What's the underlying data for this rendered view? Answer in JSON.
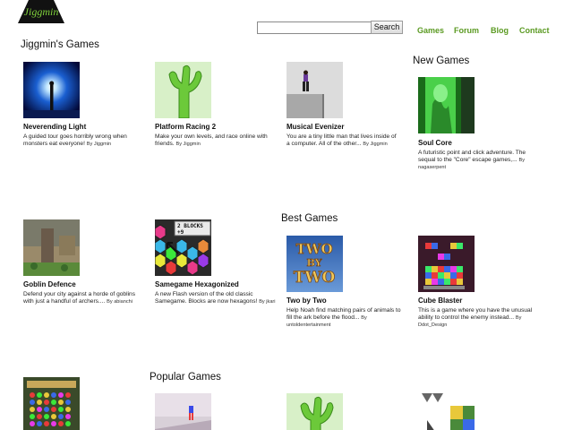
{
  "logo": {
    "text": "Jiggmin"
  },
  "search": {
    "placeholder": "",
    "button_label": "Search"
  },
  "nav": {
    "games": "Games",
    "forum": "Forum",
    "blog": "Blog",
    "contact": "Contact"
  },
  "sections": {
    "jiggmins_games": "Jiggmin's Games",
    "new_games": "New Games",
    "best_games": "Best Games",
    "popular_games": "Popular Games"
  },
  "games": {
    "neverending_light": {
      "title": "Neverending Light",
      "desc": "A guided tour goes horribly wrong when monsters eat everyone!",
      "by": "By Jiggmin"
    },
    "platform_racing_2": {
      "title": "Platform Racing 2",
      "desc": "Make your own levels, and race online with friends.",
      "by": "By Jiggmin"
    },
    "musical_evenizer": {
      "title": "Musical Evenizer",
      "desc": "You are a tiny little man that lives inside of a computer. All of the other...",
      "by": "By Jiggmin"
    },
    "soul_core": {
      "title": "Soul Core",
      "desc": "A futuristic point and click adventure. The sequal to the \"Core\" escape games,...",
      "by": "By nagaserpent"
    },
    "goblin_defence": {
      "title": "Goblin Defence",
      "desc": "Defend your city against a horde of goblins with just a handful of archers....",
      "by": "By abianchi"
    },
    "samegame_hexagonized": {
      "title": "Samegame Hexagonized",
      "desc": "A new Flash version of the old classic Samegame. Blocks are now hexagons!",
      "by": "By jkari",
      "thumb_text": "2 BLOCKS",
      "thumb_score": "+9"
    },
    "two_by_two": {
      "title": "Two by Two",
      "desc": "Help Noah find matching pairs of animals to fill the ark before the flood...",
      "by": "By untoldentertainment",
      "thumb_text_top": "TWO",
      "thumb_text_mid": "BY",
      "thumb_text_bot": "TWO"
    },
    "cube_blaster": {
      "title": "Cube Blaster",
      "desc": "This is a game where you have the unusual ability to control the enemy instead...",
      "by": "By Ddot_Design"
    }
  },
  "colors": {
    "nav_green": "#5b9a22",
    "background": "#ffffff"
  }
}
